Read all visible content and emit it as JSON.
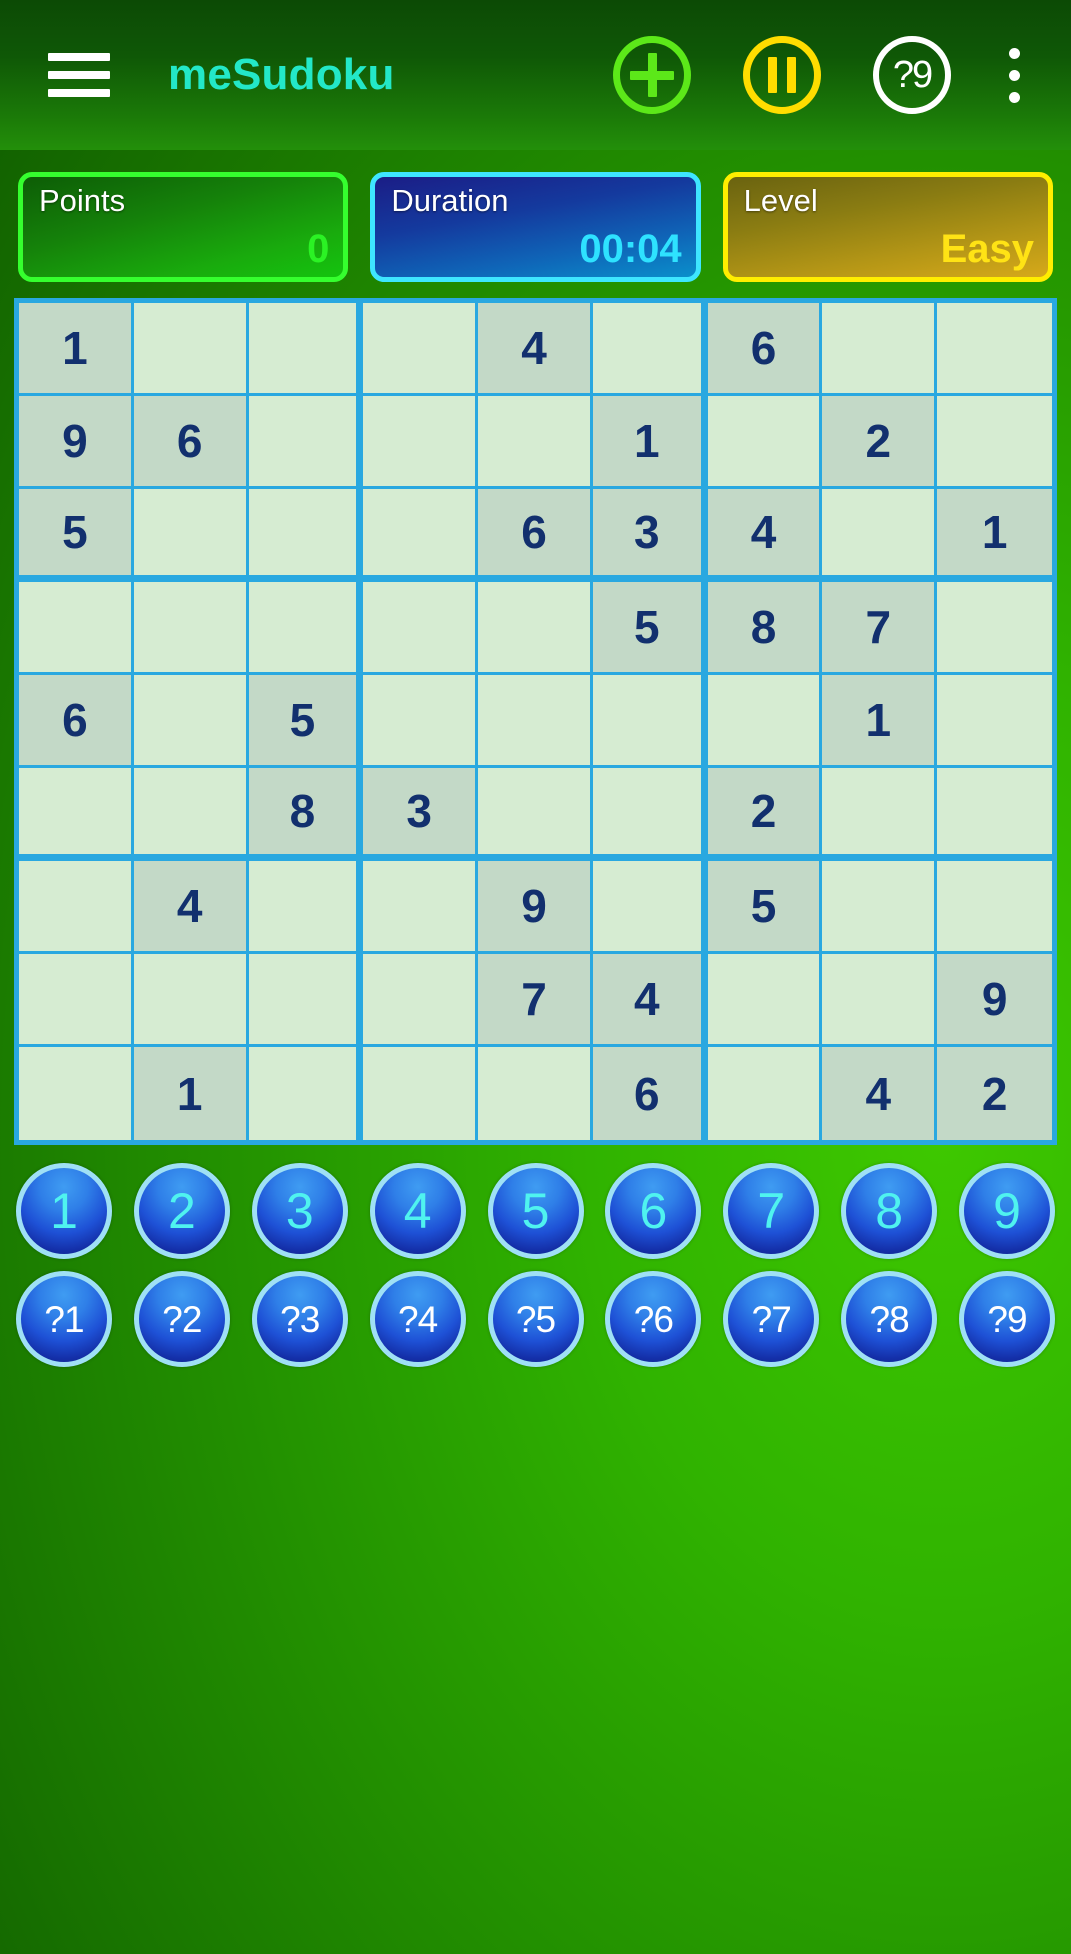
{
  "appbar": {
    "menu_icon": "hamburger-menu-icon",
    "title": "meSudoku",
    "add_icon": "plus-circle-icon",
    "pause_icon": "pause-circle-icon",
    "hint_label": "?9",
    "overflow_icon": "more-vertical-icon",
    "title_color": "#23e8c8"
  },
  "status": {
    "points": {
      "label": "Points",
      "value": "0",
      "accent": "#35ff2e"
    },
    "duration": {
      "label": "Duration",
      "value": "00:04",
      "accent": "#3ee6ff"
    },
    "level": {
      "label": "Level",
      "value": "Easy",
      "accent": "#ffee00"
    }
  },
  "board": {
    "grid_line_color": "#29a8e0",
    "cell_empty_color": "#d6ecd2",
    "cell_filled_color": "#c3d9c7",
    "digit_color": "#12306e",
    "rows": [
      [
        "1",
        "",
        "",
        "",
        "4",
        "",
        "6",
        "",
        ""
      ],
      [
        "9",
        "6",
        "",
        "",
        "",
        "1",
        "",
        "2",
        ""
      ],
      [
        "5",
        "",
        "",
        "",
        "6",
        "3",
        "4",
        "",
        "1"
      ],
      [
        "",
        "",
        "",
        "",
        "",
        "5",
        "8",
        "7",
        ""
      ],
      [
        "6",
        "",
        "5",
        "",
        "",
        "",
        "",
        "1",
        ""
      ],
      [
        "",
        "",
        "8",
        "3",
        "",
        "",
        "2",
        "",
        ""
      ],
      [
        "",
        "4",
        "",
        "",
        "9",
        "",
        "5",
        "",
        ""
      ],
      [
        "",
        "",
        "",
        "",
        "7",
        "4",
        "",
        "",
        "9"
      ],
      [
        "",
        "1",
        "",
        "",
        "",
        "6",
        "",
        "4",
        "2"
      ]
    ]
  },
  "numpad": {
    "digits": [
      "1",
      "2",
      "3",
      "4",
      "5",
      "6",
      "7",
      "8",
      "9"
    ],
    "hints": [
      "?1",
      "?2",
      "?3",
      "?4",
      "?5",
      "?6",
      "?7",
      "?8",
      "?9"
    ],
    "digit_color": "#4ff3ef",
    "hint_color": "#ffffff",
    "ring_color": "#9fe0f5"
  }
}
